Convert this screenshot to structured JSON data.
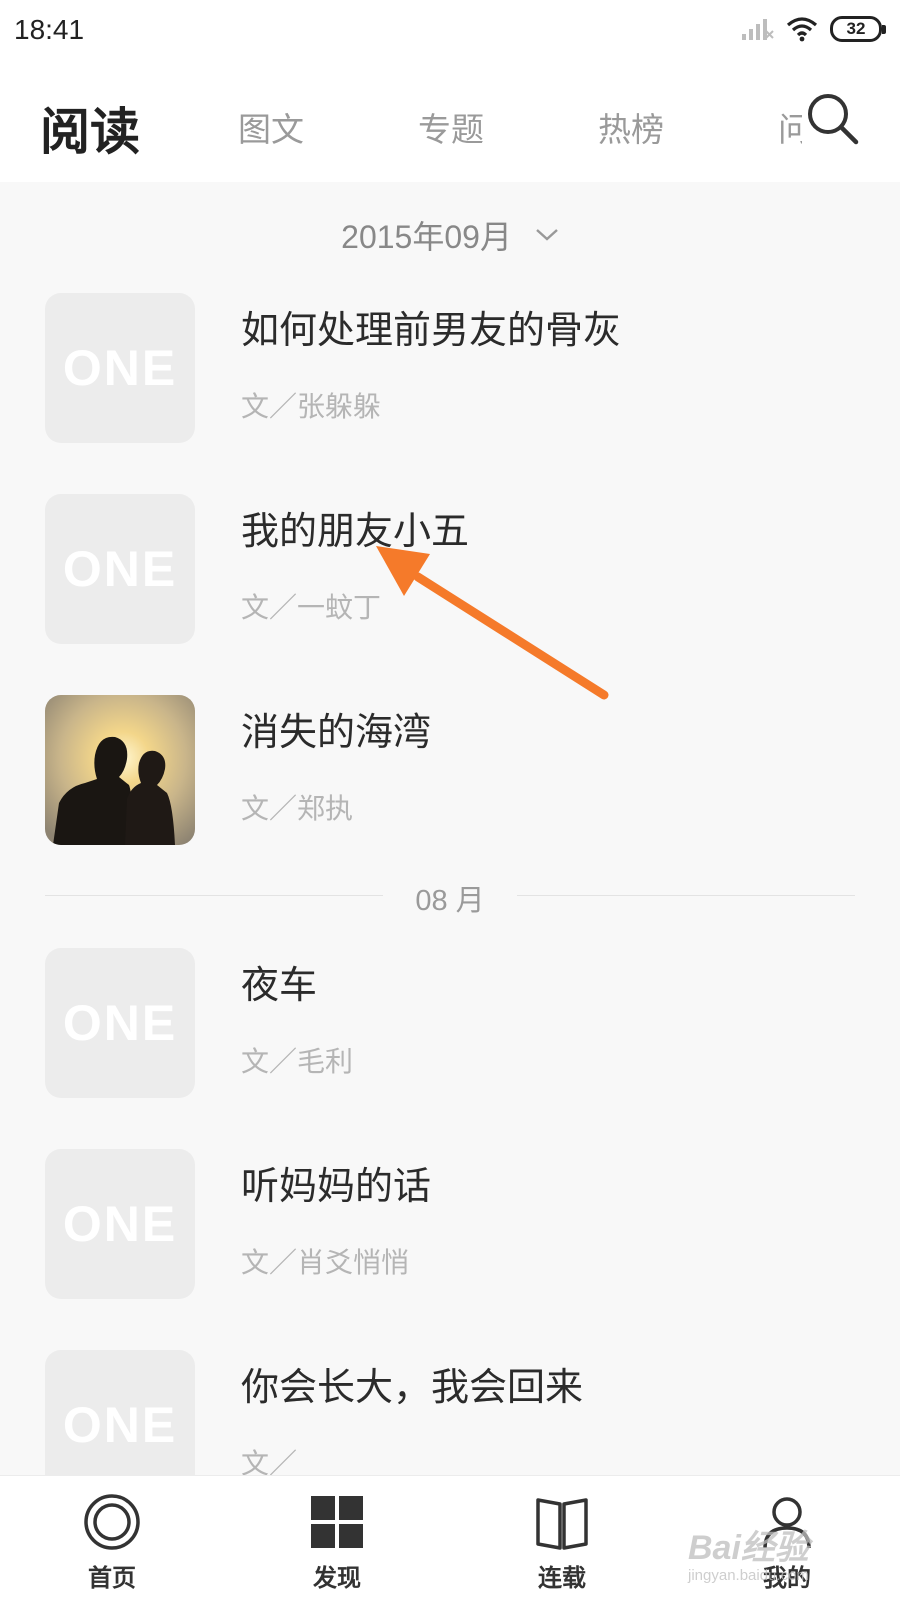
{
  "status_bar": {
    "time": "18:41",
    "battery": "32",
    "icons": [
      "signal-icon",
      "wifi-icon",
      "battery-icon"
    ]
  },
  "header": {
    "title": "阅读",
    "tabs": [
      {
        "label": "图文"
      },
      {
        "label": "专题"
      },
      {
        "label": "热榜"
      },
      {
        "label": "问答"
      }
    ]
  },
  "month_picker": {
    "label": "2015年09月"
  },
  "articles_september": [
    {
      "title": "如何处理前男友的骨灰",
      "author": "文／张躲躲",
      "thumb": "ONE"
    },
    {
      "title": "我的朋友小五",
      "author": "文／一蚊丁",
      "thumb": "ONE"
    },
    {
      "title": "消失的海湾",
      "author": "文／郑执",
      "thumb": "photo-couple-silhouette"
    }
  ],
  "section_divider": {
    "label": "08 月"
  },
  "articles_august": [
    {
      "title": "夜车",
      "author": "文／毛利",
      "thumb": "ONE"
    },
    {
      "title": "听妈妈的话",
      "author": "文／肖爻悄悄",
      "thumb": "ONE"
    },
    {
      "title": "你会长大，我会回来",
      "author": "文／",
      "thumb": "ONE"
    }
  ],
  "bottom_nav": [
    {
      "label": "首页",
      "icon": "home-circle-icon"
    },
    {
      "label": "发现",
      "icon": "grid-icon"
    },
    {
      "label": "连载",
      "icon": "book-icon"
    },
    {
      "label": "我的",
      "icon": "user-icon"
    }
  ],
  "watermark": {
    "line1": "Bai经验",
    "line2": "jingyan.baidu.com"
  },
  "colors": {
    "annotation_arrow": "#f57a2a",
    "background": "#f8f8f8",
    "thumb_placeholder": "#ececec"
  }
}
